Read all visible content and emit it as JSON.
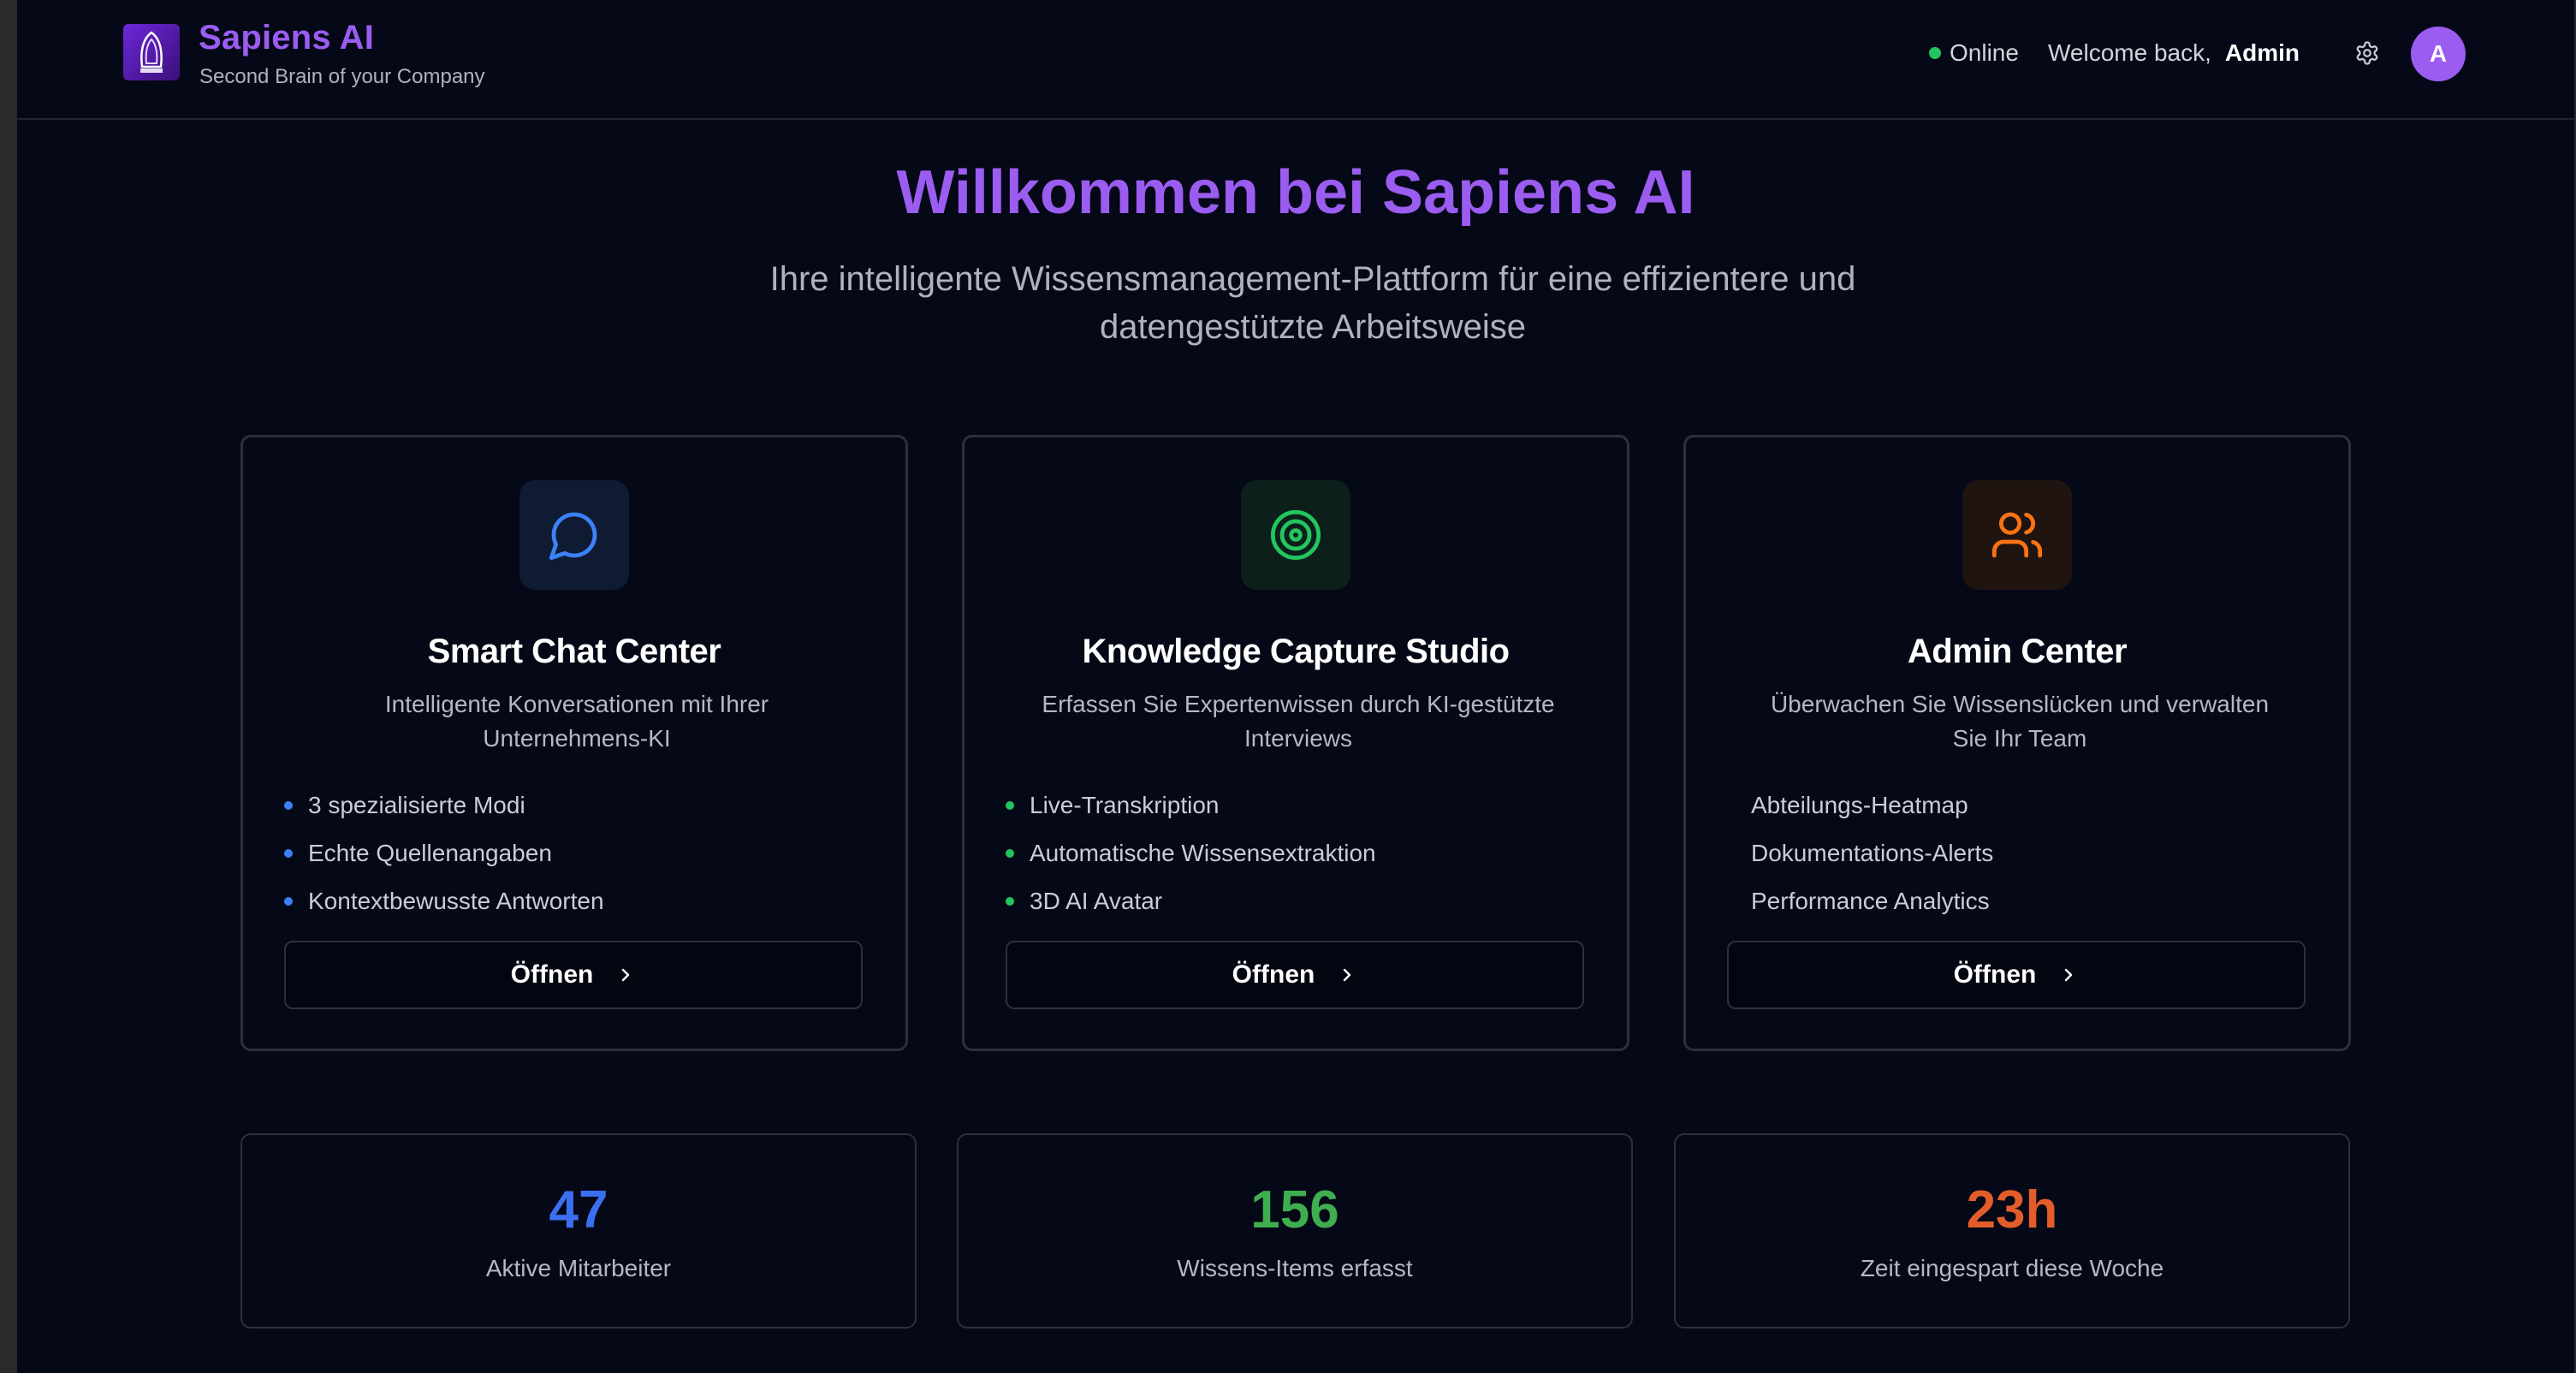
{
  "header": {
    "brand_title": "Sapiens AI",
    "brand_subtitle": "Second Brain of your Company",
    "status": "Online",
    "welcome": "Welcome back,",
    "user_name": "Admin",
    "avatar_initial": "A"
  },
  "hero": {
    "title": "Willkommen bei Sapiens AI",
    "subtitle": "Ihre intelligente Wissensmanagement-Plattform für eine effizientere und datengestützte Arbeitsweise"
  },
  "cards": [
    {
      "icon": "chat-bubble-icon",
      "title": "Smart Chat Center",
      "description": "Intelligente Konversationen mit Ihrer Unternehmens-KI",
      "features": [
        "3 spezialisierte Modi",
        "Echte Quellenangaben",
        "Kontextbewusste Antworten"
      ],
      "button": "Öffnen",
      "accent": "#3b82f6"
    },
    {
      "icon": "target-icon",
      "title": "Knowledge Capture Studio",
      "description": "Erfassen Sie Expertenwissen durch KI-gestützte Interviews",
      "features": [
        "Live-Transkription",
        "Automatische Wissensextraktion",
        "3D AI Avatar"
      ],
      "button": "Öffnen",
      "accent": "#22c55e"
    },
    {
      "icon": "users-icon",
      "title": "Admin Center",
      "description": "Überwachen Sie Wissenslücken und verwalten Sie Ihr Team",
      "features": [
        "Abteilungs-Heatmap",
        "Dokumentations-Alerts",
        "Performance Analytics"
      ],
      "button": "Öffnen",
      "accent": "#f97316"
    }
  ],
  "stats": [
    {
      "value": "47",
      "label": "Aktive Mitarbeiter",
      "color": "#3b6ff0"
    },
    {
      "value": "156",
      "label": "Wissens-Items erfasst",
      "color": "#3fae4f"
    },
    {
      "value": "23h",
      "label": "Zeit eingespart diese Woche",
      "color": "#e35d2a"
    }
  ],
  "colors": {
    "background": "#050816",
    "brand": "#9b5cf0",
    "online": "#22c55e"
  }
}
